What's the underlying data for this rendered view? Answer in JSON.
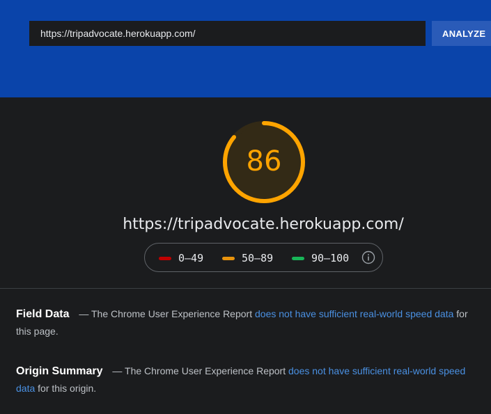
{
  "search": {
    "url_value": "https://tripadvocate.herokuapp.com/",
    "analyze_label": "ANALYZE"
  },
  "report": {
    "score": "86",
    "score_fraction": 0.86,
    "tested_url": "https://tripadvocate.herokuapp.com/",
    "legend": [
      {
        "range": "0–49",
        "color": "#ff4e42"
      },
      {
        "range": "50–89",
        "color": "#ffa400"
      },
      {
        "range": "90–100",
        "color": "#0cce6b"
      }
    ]
  },
  "field_data": {
    "title": "Field Data",
    "dash": "—",
    "text_before": "The Chrome User Experience Report",
    "link_text": "does not have sufficient real-world speed data",
    "text_after": "for this page."
  },
  "origin_summary": {
    "title": "Origin Summary",
    "dash": "—",
    "text_before": "The Chrome User Experience Report",
    "link_text": "does not have sufficient real-world speed data",
    "text_after": "for this origin."
  },
  "colors": {
    "header_bg": "#0a44aa",
    "page_bg": "#1b1c1e",
    "score_orange": "#ffa400",
    "link_blue": "#4a90e2"
  }
}
